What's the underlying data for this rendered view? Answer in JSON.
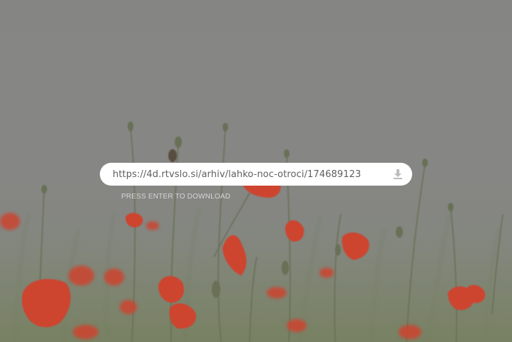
{
  "download_form": {
    "url_value": "https://4d.rtvslo.si/arhiv/lahko-noc-otroci/174689123",
    "hint": "PRESS ENTER TO DOWNLOAD",
    "action_icon": "download-icon"
  },
  "background": {
    "subject": "poppy-field-photo",
    "colors": {
      "sky": "#8c8c8a",
      "poppy": "#d9452e",
      "stem": "#6f7a5a"
    }
  }
}
